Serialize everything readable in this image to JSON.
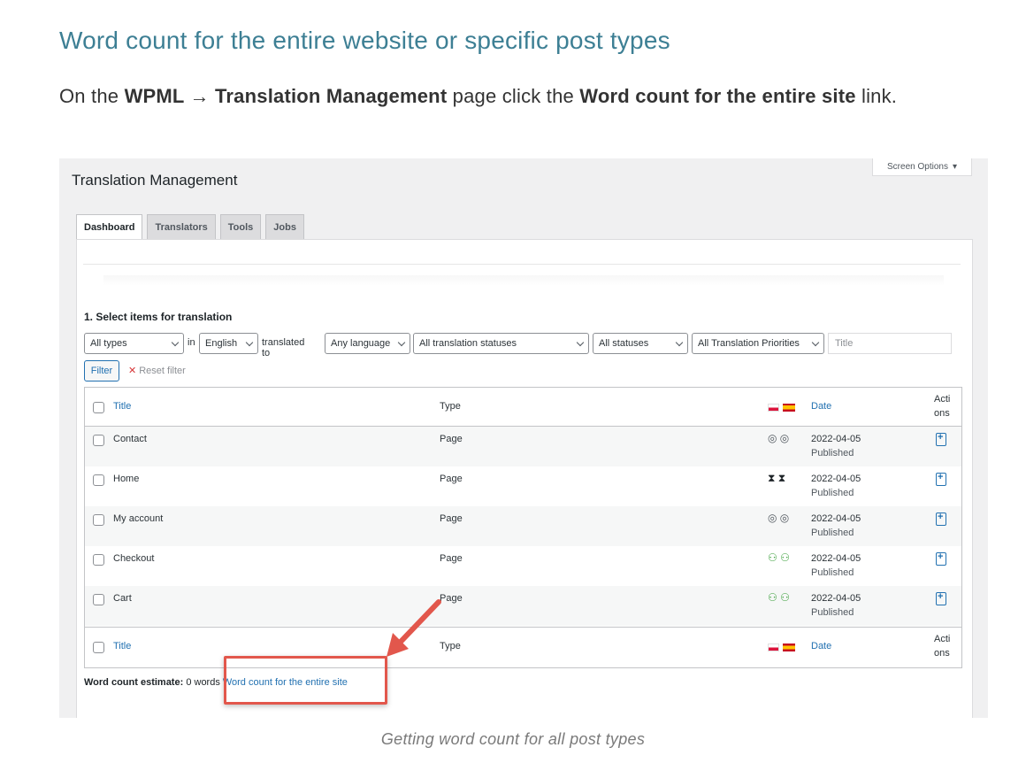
{
  "article": {
    "title": "Word count for the entire website or specific post types",
    "intro": {
      "p1": "On the ",
      "b1": "WPML",
      "arrow": " → ",
      "b2": "Translation Management",
      "p2": " page click the ",
      "b3": "Word count for the entire site",
      "p3": " link."
    },
    "caption": "Getting word count for all post types"
  },
  "screenshot": {
    "screen_options": "Screen Options",
    "page_title": "Translation Management",
    "tabs": [
      {
        "label": "Dashboard",
        "active": true
      },
      {
        "label": "Translators",
        "active": false
      },
      {
        "label": "Tools",
        "active": false
      },
      {
        "label": "Jobs",
        "active": false
      }
    ],
    "section_title": "1. Select items for translation",
    "filters": {
      "types": "All types",
      "in_label": "in",
      "language": "English",
      "translated_to_label": "translated to",
      "target_language": "Any language",
      "translation_status": "All translation statuses",
      "status": "All statuses",
      "priorities": "All Translation Priorities",
      "title_placeholder": "Title",
      "filter_button": "Filter",
      "reset": "Reset filter"
    },
    "table": {
      "columns": {
        "title": "Title",
        "type": "Type",
        "date": "Date",
        "actions_1": "Acti",
        "actions_2": "ons"
      },
      "rows": [
        {
          "title": "Contact",
          "type": "Page",
          "status_glyph": "◎ ◎",
          "date": "2022-04-05",
          "state": "Published"
        },
        {
          "title": "Home",
          "type": "Page",
          "status_glyph": "⧗ ⧗",
          "date": "2022-04-05",
          "state": "Published"
        },
        {
          "title": "My account",
          "type": "Page",
          "status_glyph": "◎ ◎",
          "date": "2022-04-05",
          "state": "Published"
        },
        {
          "title": "Checkout",
          "type": "Page",
          "status_glyph": "⚇ ⚇",
          "date": "2022-04-05",
          "state": "Published"
        },
        {
          "title": "Cart",
          "type": "Page",
          "status_glyph": "⚇ ⚇",
          "date": "2022-04-05",
          "state": "Published"
        }
      ]
    },
    "word_count": {
      "label": "Word count estimate:",
      "value": " 0 words",
      "link": "Word count for the entire site"
    }
  },
  "icons": {
    "eye": "eye-icon",
    "hourglass": "hourglass-icon",
    "translators": "translators-icon",
    "add_translation": "add-translation-icon"
  },
  "colors": {
    "title": "#3d7f94",
    "link": "#2271b1",
    "highlight": "#e2574c"
  }
}
